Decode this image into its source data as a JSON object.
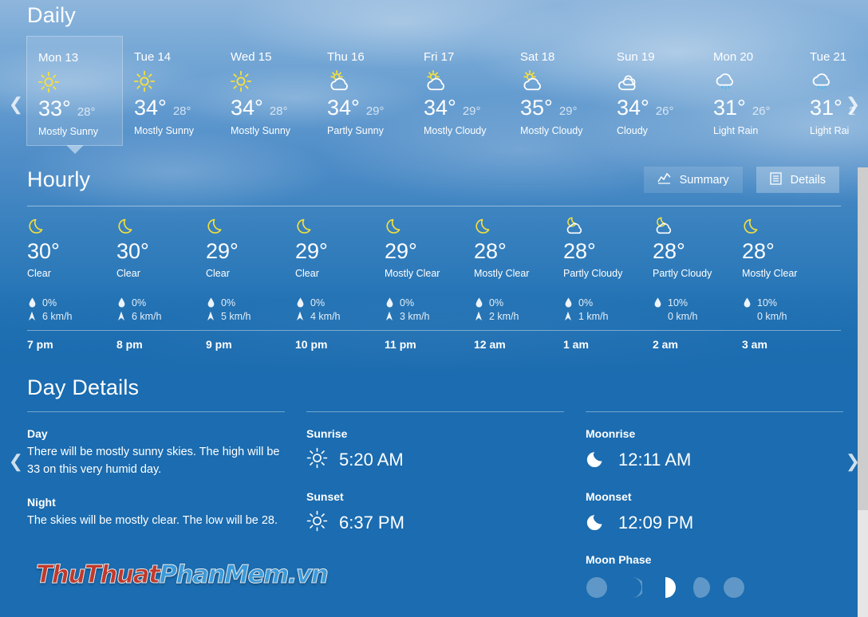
{
  "daily": {
    "title": "Daily",
    "prev_icon": "chevron-left-icon",
    "next_icon": "chevron-right-icon",
    "days": [
      {
        "name": "Mon 13",
        "icon": "sunny-icon",
        "high": "33°",
        "low": "28°",
        "desc": "Mostly Sunny",
        "selected": true
      },
      {
        "name": "Tue 14",
        "icon": "sunny-icon",
        "high": "34°",
        "low": "28°",
        "desc": "Mostly Sunny",
        "selected": false
      },
      {
        "name": "Wed 15",
        "icon": "sunny-icon",
        "high": "34°",
        "low": "28°",
        "desc": "Mostly Sunny",
        "selected": false
      },
      {
        "name": "Thu 16",
        "icon": "partly-sunny-icon",
        "high": "34°",
        "low": "29°",
        "desc": "Partly Sunny",
        "selected": false
      },
      {
        "name": "Fri 17",
        "icon": "partly-sunny-icon",
        "high": "34°",
        "low": "29°",
        "desc": "Mostly Cloudy",
        "selected": false
      },
      {
        "name": "Sat 18",
        "icon": "partly-sunny-icon",
        "high": "35°",
        "low": "29°",
        "desc": "Mostly Cloudy",
        "selected": false
      },
      {
        "name": "Sun 19",
        "icon": "cloudy-icon",
        "high": "34°",
        "low": "26°",
        "desc": "Cloudy",
        "selected": false
      },
      {
        "name": "Mon 20",
        "icon": "light-rain-icon",
        "high": "31°",
        "low": "26°",
        "desc": "Light Rain",
        "selected": false
      },
      {
        "name": "Tue 21",
        "icon": "light-rain-icon",
        "high": "31°",
        "low": "2",
        "desc": "Light Rai",
        "selected": false
      }
    ]
  },
  "hourly": {
    "title": "Hourly",
    "summary_label": "Summary",
    "summary_icon": "chart-line-icon",
    "details_label": "Details",
    "details_icon": "list-details-icon",
    "active_mode": "Details",
    "prev_icon": "chevron-left-icon",
    "next_icon": "chevron-right-icon",
    "precip_icon": "water-drop-icon",
    "wind_icon": "wind-arrow-icon",
    "hours": [
      {
        "time": "7 pm",
        "icon": "moon-icon",
        "temp": "30°",
        "desc": "Clear",
        "precip": "0%",
        "wind": "6 km/h",
        "wind_icon": true
      },
      {
        "time": "8 pm",
        "icon": "moon-icon",
        "temp": "30°",
        "desc": "Clear",
        "precip": "0%",
        "wind": "6 km/h",
        "wind_icon": true
      },
      {
        "time": "9 pm",
        "icon": "moon-icon",
        "temp": "29°",
        "desc": "Clear",
        "precip": "0%",
        "wind": "5 km/h",
        "wind_icon": true
      },
      {
        "time": "10 pm",
        "icon": "moon-icon",
        "temp": "29°",
        "desc": "Clear",
        "precip": "0%",
        "wind": "4 km/h",
        "wind_icon": true
      },
      {
        "time": "11 pm",
        "icon": "moon-icon",
        "temp": "29°",
        "desc": "Mostly Clear",
        "precip": "0%",
        "wind": "3 km/h",
        "wind_icon": true
      },
      {
        "time": "12 am",
        "icon": "moon-icon",
        "temp": "28°",
        "desc": "Mostly Clear",
        "precip": "0%",
        "wind": "2 km/h",
        "wind_icon": true
      },
      {
        "time": "1 am",
        "icon": "partly-cloudy-night-icon",
        "temp": "28°",
        "desc": "Partly Cloudy",
        "precip": "0%",
        "wind": "1 km/h",
        "wind_icon": true
      },
      {
        "time": "2 am",
        "icon": "partly-cloudy-night-icon",
        "temp": "28°",
        "desc": "Partly Cloudy",
        "precip": "10%",
        "wind": "0 km/h",
        "wind_icon": false
      },
      {
        "time": "3 am",
        "icon": "moon-icon",
        "temp": "28°",
        "desc": "Mostly Clear",
        "precip": "10%",
        "wind": "0 km/h",
        "wind_icon": false
      }
    ]
  },
  "day_details": {
    "title": "Day Details",
    "day_label": "Day",
    "day_text": "There will be mostly sunny skies. The high will be 33 on this very humid day.",
    "night_label": "Night",
    "night_text": "The skies will be mostly clear. The low will be 28.",
    "sunrise_label": "Sunrise",
    "sunrise_value": "5:20 AM",
    "sunrise_icon": "sun-icon",
    "sunset_label": "Sunset",
    "sunset_value": "6:37 PM",
    "sunset_icon": "sun-icon",
    "moonrise_label": "Moonrise",
    "moonrise_value": "12:11 AM",
    "moonrise_icon": "moonrise-icon",
    "moonset_label": "Moonset",
    "moonset_value": "12:09 PM",
    "moonset_icon": "moonset-icon",
    "moon_phase_label": "Moon Phase",
    "moon_phases": [
      {
        "name": "new-moon",
        "active": false
      },
      {
        "name": "waxing-crescent",
        "active": false
      },
      {
        "name": "first-quarter",
        "active": true
      },
      {
        "name": "waxing-gibbous",
        "active": false
      },
      {
        "name": "full-moon",
        "active": false
      }
    ]
  },
  "watermark": {
    "part1": "ThuThuat",
    "part2": "PhanMem.vn"
  },
  "colors": {
    "background": "#1b6cb0",
    "sun_yellow": "#f5e03c",
    "rain_blue": "#4fb8e8",
    "text": "#ffffff",
    "watermark_red": "#c0392b",
    "watermark_blue": "#3a9ad9"
  }
}
